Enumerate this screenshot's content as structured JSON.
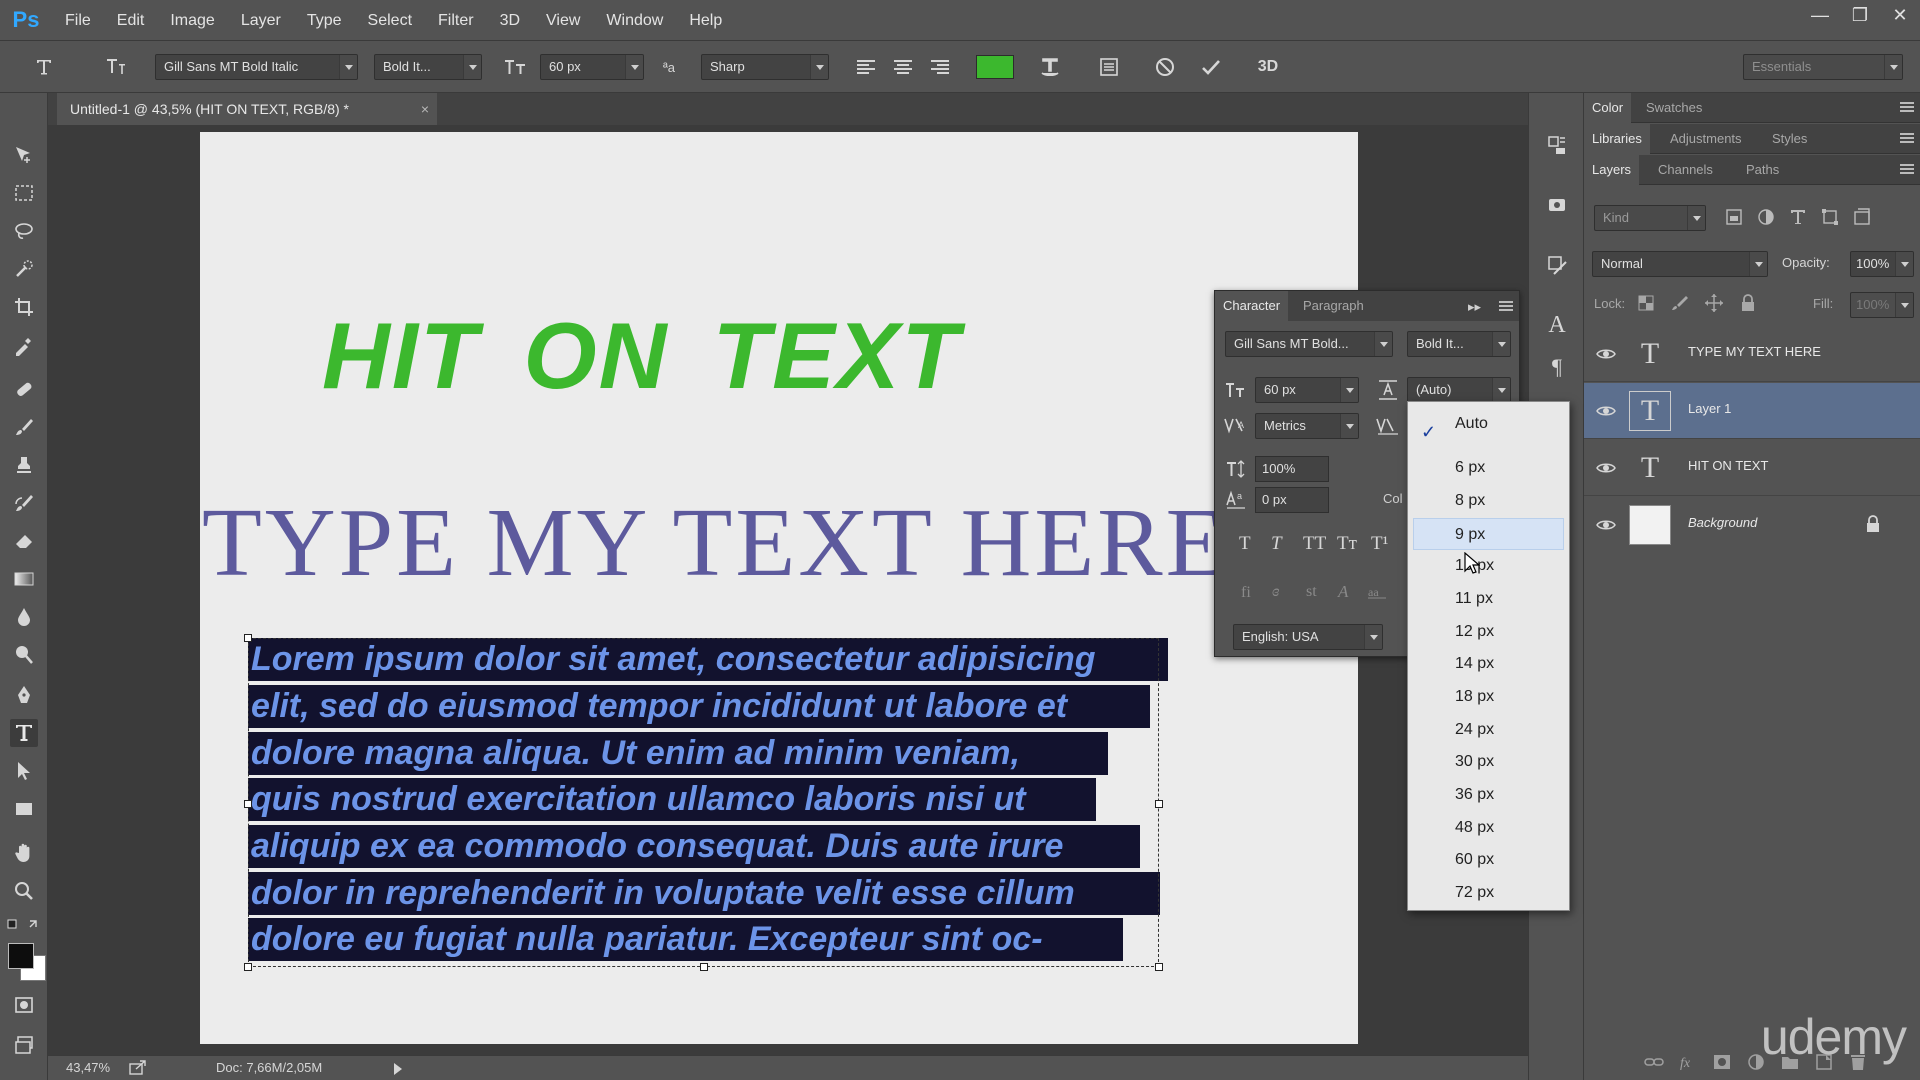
{
  "app": {
    "logo": "Ps"
  },
  "menu": [
    "File",
    "Edit",
    "Image",
    "Layer",
    "Type",
    "Select",
    "Filter",
    "3D",
    "View",
    "Window",
    "Help"
  ],
  "window_controls": {
    "minimize": "—",
    "restore": "❐",
    "close": "✕"
  },
  "options_bar": {
    "font_family": "Gill Sans MT Bold Italic",
    "font_style": "Bold It...",
    "font_size": "60 px",
    "antialias": "Sharp",
    "text_color": "#3cb82e",
    "workspace": "Essentials"
  },
  "document": {
    "tab_title": "Untitled-1 @ 43,5% (HIT ON  TEXT, RGB/8) *",
    "close": "×",
    "headline": "HIT ON  TEXT",
    "serif_line": "TYPE MY TEXT HERE",
    "paragraph_lines": [
      "Lorem ipsum dolor sit amet, consectetur adipisicing",
      "elit, sed do eiusmod tempor incididunt ut labore et",
      "dolore magna aliqua. Ut enim ad minim veniam,",
      "quis nostrud exercitation ullamco laboris nisi ut",
      "aliquip ex ea commodo consequat. Duis aute irure",
      "dolor in reprehenderit in voluptate velit esse cillum",
      "dolore eu fugiat nulla pariatur. Excepteur sint oc-"
    ]
  },
  "status_bar": {
    "zoom": "43,47%",
    "doc": "Doc: 7,66M/2,05M"
  },
  "panels": {
    "row1_tabs": [
      "Color",
      "Swatches"
    ],
    "row2_tabs": [
      "Libraries",
      "Adjustments",
      "Styles"
    ],
    "row3_tabs": [
      "Layers",
      "Channels",
      "Paths"
    ],
    "kind_placeholder": "Kind",
    "blend_mode": "Normal",
    "opacity_label": "Opacity:",
    "opacity_value": "100%",
    "lock_label": "Lock:",
    "fill_label": "Fill:",
    "fill_value": "100%"
  },
  "layers": [
    {
      "name": "TYPE MY TEXT HERE",
      "type": "text",
      "selected": false
    },
    {
      "name": "Layer 1",
      "type": "text",
      "selected": true
    },
    {
      "name": "HIT ON  TEXT",
      "type": "text",
      "selected": false
    },
    {
      "name": "Background",
      "type": "image",
      "selected": false,
      "locked": true
    }
  ],
  "character_panel": {
    "tabs": [
      "Character",
      "Paragraph"
    ],
    "font_family": "Gill Sans MT Bold...",
    "font_style": "Bold It...",
    "size": "60 px",
    "leading": "(Auto)",
    "kerning": "Metrics",
    "vertical_scale": "100%",
    "baseline_shift": "0 px",
    "color_label": "Col",
    "style_buttons": [
      "T",
      "T",
      "TT",
      "Tт",
      "T¹"
    ],
    "language": "English: USA"
  },
  "leading_dropdown": {
    "options": [
      "Auto",
      "6 px",
      "8 px",
      "9 px",
      "10 px",
      "11 px",
      "12 px",
      "14 px",
      "18 px",
      "24 px",
      "30 px",
      "36 px",
      "48 px",
      "60 px",
      "72 px"
    ],
    "checked": "Auto",
    "hovered": "9 px"
  },
  "watermark": "udemy"
}
